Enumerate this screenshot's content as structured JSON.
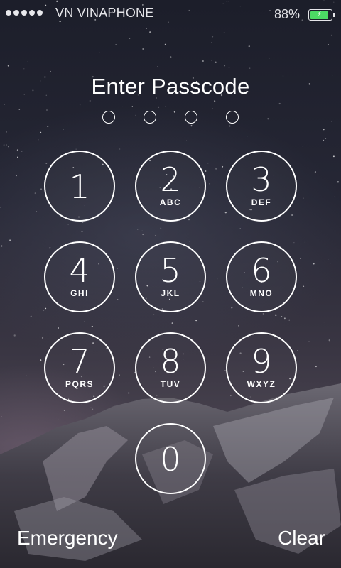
{
  "status_bar": {
    "signal_icon": "signal-dots-icon",
    "carrier": "VN VINAPHONE",
    "battery_percent": "88%",
    "battery_icon": "battery-charging-icon",
    "battery_level": 0.88,
    "battery_color": "#4cd964"
  },
  "passcode": {
    "prompt": "Enter Passcode",
    "length": 4,
    "entered": 0
  },
  "keypad": {
    "keys": [
      {
        "digit": "1",
        "letters": ""
      },
      {
        "digit": "2",
        "letters": "ABC"
      },
      {
        "digit": "3",
        "letters": "DEF"
      },
      {
        "digit": "4",
        "letters": "GHI"
      },
      {
        "digit": "5",
        "letters": "JKL"
      },
      {
        "digit": "6",
        "letters": "MNO"
      },
      {
        "digit": "7",
        "letters": "PQRS"
      },
      {
        "digit": "8",
        "letters": "TUV"
      },
      {
        "digit": "9",
        "letters": "WXYZ"
      },
      {
        "digit": "0",
        "letters": ""
      }
    ]
  },
  "actions": {
    "emergency": "Emergency",
    "clear": "Clear"
  }
}
